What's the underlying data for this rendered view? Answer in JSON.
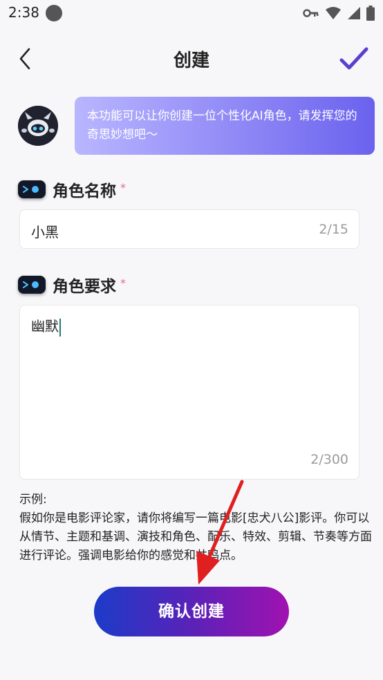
{
  "status_bar": {
    "time": "2:38"
  },
  "header": {
    "title": "创建"
  },
  "intro": {
    "text": "本功能可以让你创建一位个性化AI角色，请发挥您的奇思妙想吧～"
  },
  "name_section": {
    "label": "角色名称",
    "required": "*",
    "value": "小黑",
    "counter": "2/15"
  },
  "requirement_section": {
    "label": "角色要求",
    "required": "*",
    "value": "幽默",
    "counter": "2/300"
  },
  "example": {
    "heading": "示例:",
    "body": "假如你是电影评论家，请你将编写一篇电影[忠犬八公]影评。你可以从情节、主题和基调、演技和角色、配乐、特效、剪辑、节奏等方面进行评论。强调电影给你的感觉和共鸣点。"
  },
  "create_button": {
    "label": "确认创建"
  },
  "colors": {
    "accent": "#5b3fd0",
    "required": "#e46a8a",
    "annotation": "#e02020"
  }
}
